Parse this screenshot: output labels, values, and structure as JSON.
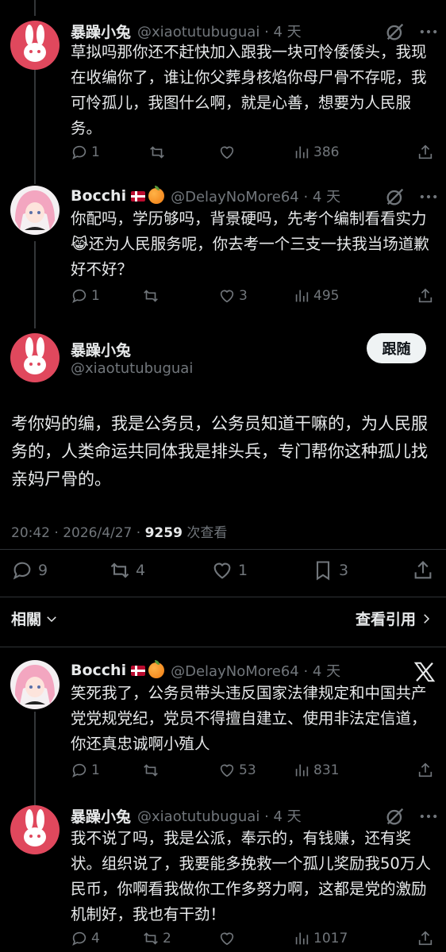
{
  "tweets": [
    {
      "name": "暴躁小兔",
      "handle": "@xiaotutubuguai · 4 天",
      "text": "草拟吗那你还不赶快加入跟我一块可怜倭倭头，我现在收编你了，谁让你父葬身核焰你母尸骨不存呢，我可怜孤儿，我图什么啊，就是心善，想要为人民服务。",
      "replies": "1",
      "retweets": "",
      "likes": "",
      "views": "386"
    },
    {
      "name": "Bocchi",
      "handle": "@DelayNoMore64 · 4 天",
      "text": "你配吗，学历够吗，背景硬吗，先考个编制看看实力😹还为人民服务呢，你去考一个三支一扶我当场道歉好不好？",
      "replies": "1",
      "retweets": "",
      "likes": "3",
      "views": "495"
    },
    {
      "name": "Bocchi",
      "handle": "@DelayNoMore64 · 4 天",
      "text": "笑死我了，公务员带头违反国家法律规定和中国共产党党规党纪，党员不得擅自建立、使用非法定信道，你还真忠诚啊小殖人",
      "replies": "1",
      "retweets": "",
      "likes": "53",
      "views": "831"
    },
    {
      "name": "暴躁小兔",
      "handle": "@xiaotutubuguai · 4 天",
      "text": "我不说了吗，我是公派，奉示的，有钱赚，还有奖状。组织说了，我要能多挽救一个孤儿奖励我50万人民币，你啊看我做你工作多努力啊，这都是党的激励机制好，我也有干劲！",
      "replies": "4",
      "retweets": "2",
      "likes": "",
      "views": "1017"
    }
  ],
  "main": {
    "name": "暴躁小兔",
    "handle": "@xiaotutubuguai",
    "follow_label": "跟随",
    "text": "考你妈的编，我是公务员，公务员知道干嘛的，为人民服务的，人类命运共同体我是排头兵，专门帮你这种孤儿找亲妈尸骨的。",
    "time": "20:42 · 2026/4/27 · ",
    "views_count": "9259",
    "views_label": " 次查看",
    "replies": "9",
    "retweets": "4",
    "likes": "1",
    "bookmarks": "3",
    "related_label": "相關",
    "quotes_label": "查看引用"
  },
  "colors": {
    "rabbit_avatar": "#e0485d",
    "muted": "#71767b",
    "text": "#e7e9ea"
  }
}
